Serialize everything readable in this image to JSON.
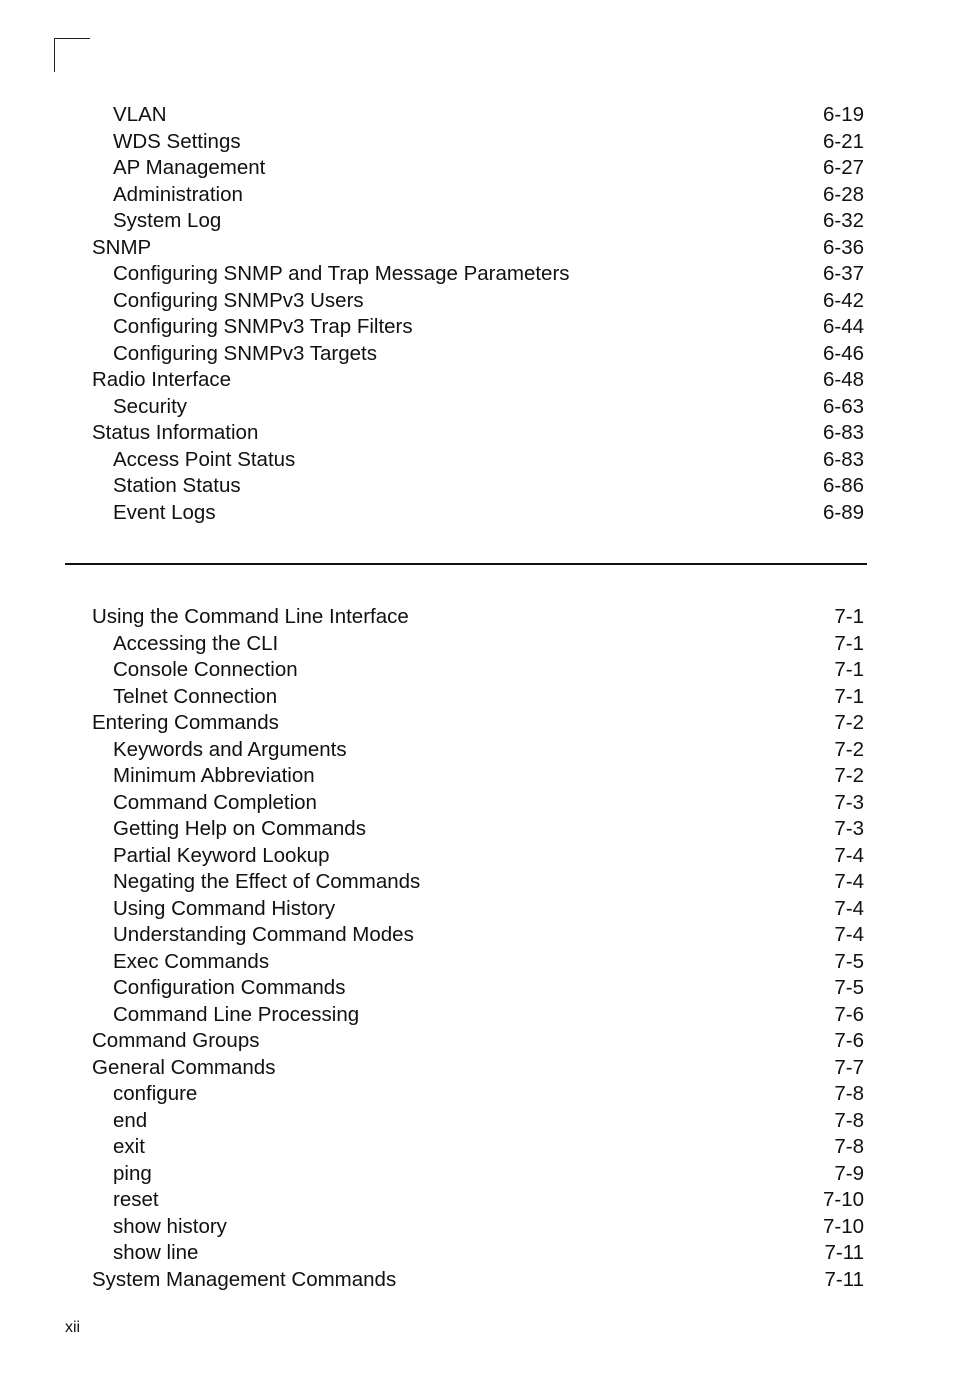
{
  "document": {
    "page_number": "xii",
    "sections": [
      {
        "entries": [
          {
            "title": "VLAN",
            "page": "6-19",
            "level": 2
          },
          {
            "title": "WDS Settings",
            "page": "6-21",
            "level": 2
          },
          {
            "title": "AP Management",
            "page": "6-27",
            "level": 2
          },
          {
            "title": "Administration",
            "page": "6-28",
            "level": 2
          },
          {
            "title": "System Log",
            "page": "6-32",
            "level": 2
          },
          {
            "title": "SNMP",
            "page": "6-36",
            "level": 1
          },
          {
            "title": "Configuring SNMP and Trap Message Parameters",
            "page": "6-37",
            "level": 2
          },
          {
            "title": "Configuring SNMPv3 Users",
            "page": "6-42",
            "level": 2
          },
          {
            "title": "Configuring SNMPv3 Trap Filters",
            "page": "6-44",
            "level": 2
          },
          {
            "title": "Configuring SNMPv3 Targets",
            "page": "6-46",
            "level": 2
          },
          {
            "title": "Radio Interface",
            "page": "6-48",
            "level": 1
          },
          {
            "title": "Security",
            "page": "6-63",
            "level": 2
          },
          {
            "title": "Status Information",
            "page": "6-83",
            "level": 1
          },
          {
            "title": "Access Point Status",
            "page": "6-83",
            "level": 2
          },
          {
            "title": "Station Status",
            "page": "6-86",
            "level": 2
          },
          {
            "title": "Event Logs",
            "page": "6-89",
            "level": 2
          }
        ]
      },
      {
        "entries": [
          {
            "title": "Using the Command Line Interface",
            "page": "7-1",
            "level": 1
          },
          {
            "title": "Accessing the CLI",
            "page": "7-1",
            "level": 2
          },
          {
            "title": "Console Connection",
            "page": "7-1",
            "level": 2
          },
          {
            "title": "Telnet Connection",
            "page": "7-1",
            "level": 2
          },
          {
            "title": "Entering Commands",
            "page": "7-2",
            "level": 1
          },
          {
            "title": "Keywords and Arguments",
            "page": "7-2",
            "level": 2
          },
          {
            "title": "Minimum Abbreviation",
            "page": "7-2",
            "level": 2
          },
          {
            "title": "Command Completion",
            "page": "7-3",
            "level": 2
          },
          {
            "title": "Getting Help on Commands",
            "page": "7-3",
            "level": 2
          },
          {
            "title": "Partial Keyword Lookup",
            "page": "7-4",
            "level": 2
          },
          {
            "title": "Negating the Effect of Commands",
            "page": "7-4",
            "level": 2
          },
          {
            "title": "Using Command History",
            "page": "7-4",
            "level": 2
          },
          {
            "title": "Understanding Command Modes",
            "page": "7-4",
            "level": 2
          },
          {
            "title": "Exec Commands",
            "page": "7-5",
            "level": 2
          },
          {
            "title": "Configuration Commands",
            "page": "7-5",
            "level": 2
          },
          {
            "title": "Command Line Processing",
            "page": "7-6",
            "level": 2
          },
          {
            "title": "Command Groups",
            "page": "7-6",
            "level": 1
          },
          {
            "title": "General Commands",
            "page": "7-7",
            "level": 1
          },
          {
            "title": "configure",
            "page": "7-8",
            "level": 2
          },
          {
            "title": "end",
            "page": "7-8",
            "level": 2
          },
          {
            "title": "exit",
            "page": "7-8",
            "level": 2
          },
          {
            "title": "ping",
            "page": "7-9",
            "level": 2
          },
          {
            "title": "reset",
            "page": "7-10",
            "level": 2
          },
          {
            "title": "show history",
            "page": "7-10",
            "level": 2
          },
          {
            "title": "show line",
            "page": "7-11",
            "level": 2
          },
          {
            "title": "System Management Commands",
            "page": "7-11",
            "level": 1
          }
        ]
      }
    ]
  }
}
